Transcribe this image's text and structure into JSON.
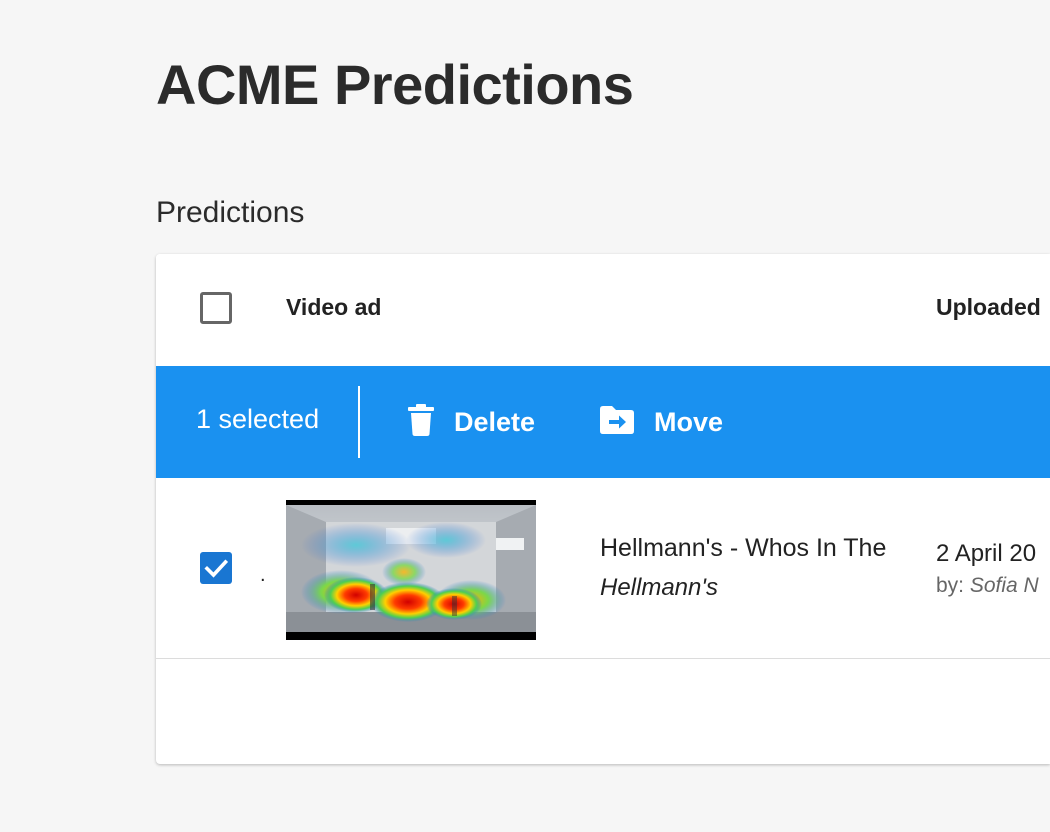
{
  "app": {
    "title": "ACME Predictions"
  },
  "section": {
    "title": "Predictions"
  },
  "table": {
    "columns": {
      "video_ad": "Video ad",
      "uploaded": "Uploaded"
    },
    "selection_bar": {
      "selected_text": "1 selected",
      "delete_label": "Delete",
      "move_label": "Move"
    },
    "rows": [
      {
        "checked": true,
        "marker": ".",
        "title": "Hellmann's - Whos In The",
        "brand": "Hellmann's",
        "date": "2 April 20",
        "uploader_prefix": "by:",
        "uploader_name": "Sofia N"
      }
    ]
  },
  "colors": {
    "background": "#f6f6f6",
    "accent_bar": "#1a91f0",
    "checkbox_checked": "#1976d2",
    "card": "#ffffff"
  },
  "icons": {
    "delete": "trash-icon",
    "move": "folder-move-icon",
    "check": "checkmark-icon"
  }
}
